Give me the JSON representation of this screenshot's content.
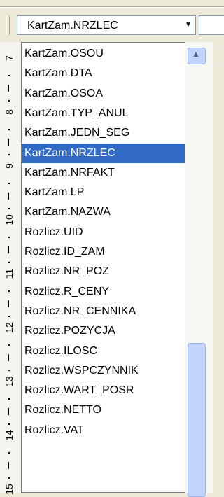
{
  "toolbar": {
    "combo_value": "KartZam.NRZLEC",
    "dropdown_arrow": "▼"
  },
  "ruler": {
    "numbers": [
      "7",
      "8",
      "9",
      "10",
      "11",
      "12",
      "13",
      "14",
      "15"
    ]
  },
  "list": {
    "selected_index": 5,
    "items": [
      "KartZam.OSOU",
      "KartZam.DTA",
      "KartZam.OSOA",
      "KartZam.TYP_ANUL",
      "KartZam.JEDN_SEG",
      "KartZam.NRZLEC",
      "KartZam.NRFAKT",
      "KartZam.LP",
      "KartZam.NAZWA",
      "Rozlicz.UID",
      "Rozlicz.ID_ZAM",
      "Rozlicz.NR_POZ",
      "Rozlicz.R_CENY",
      "Rozlicz.NR_CENNIKA",
      "Rozlicz.POZYCJA",
      "Rozlicz.ILOSC",
      "Rozlicz.WSPCZYNNIK",
      "Rozlicz.WART_POSR",
      "Rozlicz.NETTO",
      "Rozlicz.VAT"
    ]
  },
  "scrollbar": {
    "up_arrow": "▲"
  }
}
